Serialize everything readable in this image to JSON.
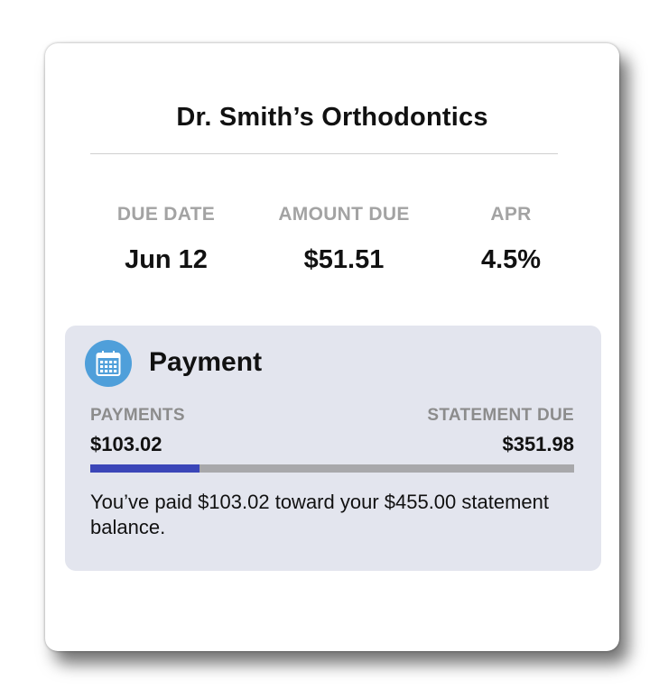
{
  "header": {
    "title": "Dr. Smith’s Orthodontics"
  },
  "stats": [
    {
      "label": "DUE DATE",
      "value": "Jun 12"
    },
    {
      "label": "AMOUNT DUE",
      "value": "$51.51"
    },
    {
      "label": "APR",
      "value": "4.5%"
    }
  ],
  "payment": {
    "icon": "calendar-icon",
    "title": "Payment",
    "payments_label": "PAYMENTS",
    "payments_value": "$103.02",
    "statement_due_label": "STATEMENT DUE",
    "statement_due_value": "$351.98",
    "progress_fraction": 0.2264,
    "summary": "You’ve paid $103.02 toward your $455.00 statement balance."
  },
  "colors": {
    "icon_bg": "#4f9fda",
    "panel_bg": "#e3e5ee",
    "progress_fill": "#3b46b8",
    "progress_track": "#a8a8ab"
  }
}
